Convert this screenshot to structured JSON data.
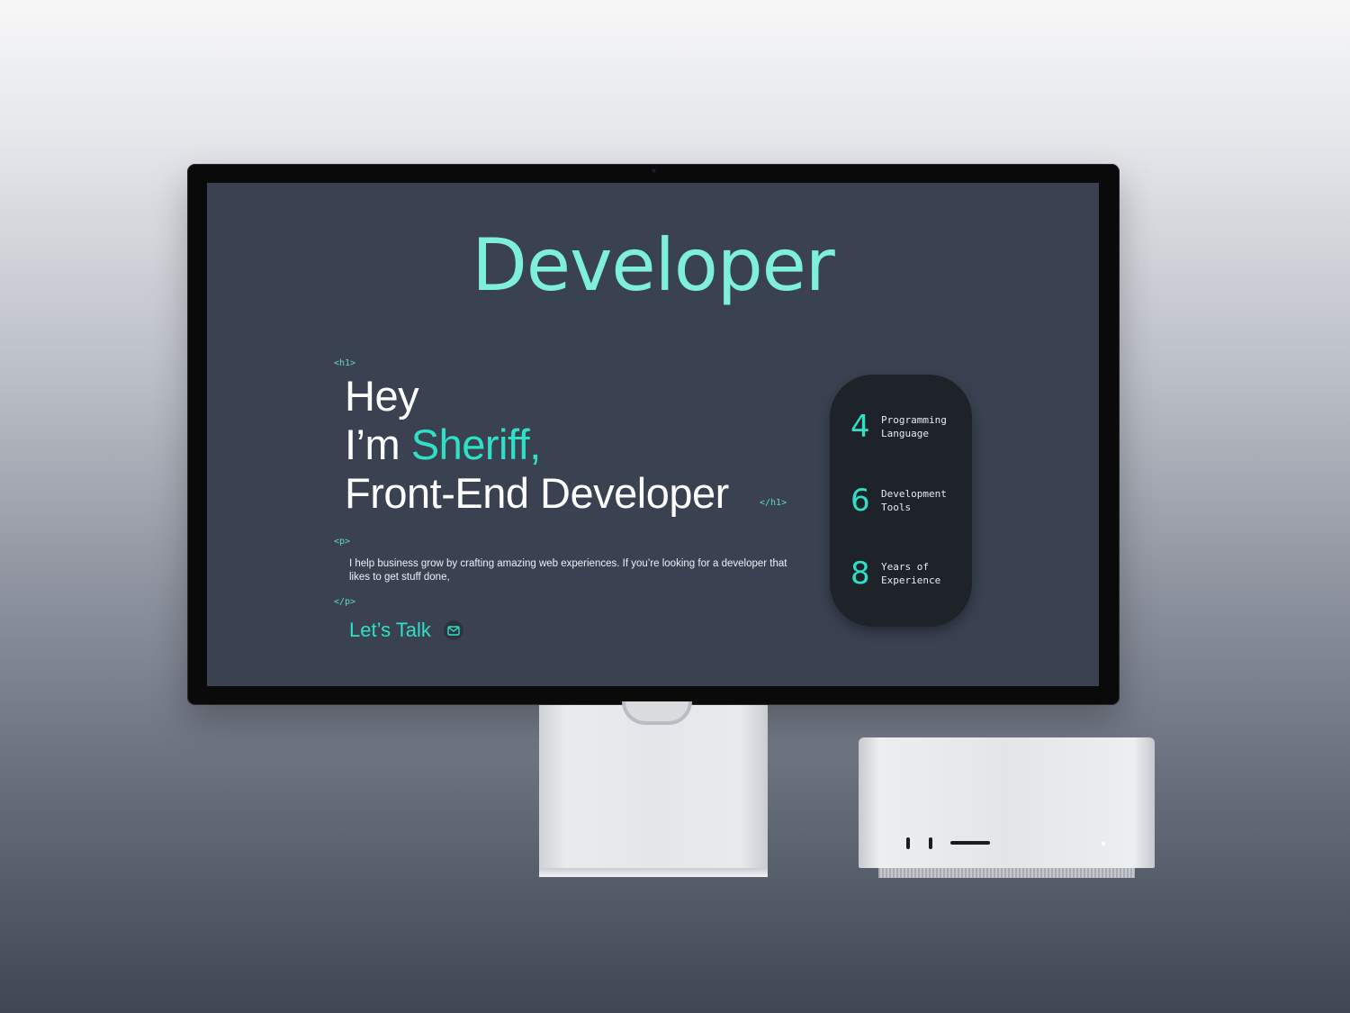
{
  "screen": {
    "hero_word": "Developer",
    "tags": {
      "h1_open": "<h1>",
      "h1_close": "</h1>",
      "p_open": "<p>",
      "p_close": "</p>"
    },
    "headline": {
      "line1": "Hey",
      "line2_prefix": "I’m ",
      "line2_name": "Sheriff,",
      "line3": "Front-End Developer"
    },
    "intro": "I help business grow by crafting amazing web experiences. If you’re looking for a developer that likes to get stuff done,",
    "cta": {
      "label": "Let’s Talk",
      "icon": "mail-icon"
    },
    "stats": [
      {
        "value": "4",
        "label": "Programming\nLanguage"
      },
      {
        "value": "6",
        "label": "Development\nTools"
      },
      {
        "value": "8",
        "label": "Years of\nExperience"
      }
    ]
  },
  "colors": {
    "screen_bg": "#3a4252",
    "accent": "#2fe0c6",
    "hero_word": "#7ef0da",
    "pill_bg": "#1e2229"
  }
}
